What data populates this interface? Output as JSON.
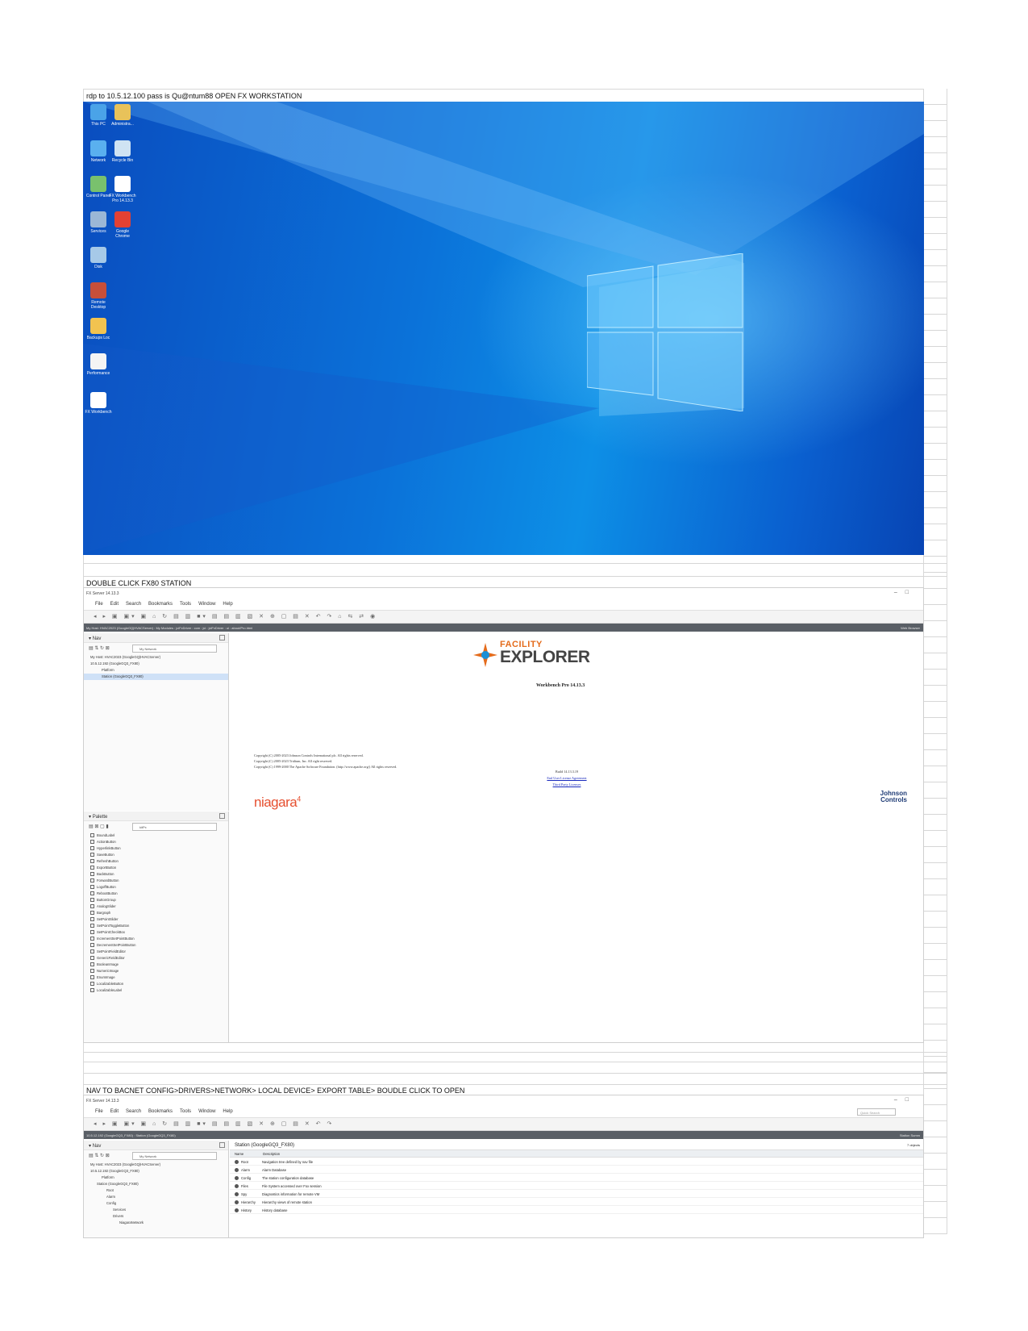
{
  "steps": {
    "step1": "rdp to 10.5.12.100 pass is Qu@ntum88     OPEN FX WORKSTATION",
    "step2": "DOUBLE CLICK FX80 STATION",
    "step3": "NAV TO BACNET CONFIG>DRIVERS>NETWORK> LOCAL DEVICE> EXPORT TABLE> BOUDLE CLICK TO OPEN"
  },
  "desktop": {
    "icons": [
      {
        "label": "This PC",
        "icon": "computer-icon",
        "color": "#4aa3e8"
      },
      {
        "label": "Administra...",
        "icon": "user-folder-icon",
        "color": "#e8c25a"
      },
      {
        "label": "Network",
        "icon": "network-icon",
        "color": "#5ab0ef"
      },
      {
        "label": "Recycle Bin",
        "icon": "recycle-bin-icon",
        "color": "#cfe3f3"
      },
      {
        "label": "Control Panel",
        "icon": "control-panel-icon",
        "color": "#79c16d"
      },
      {
        "label": "FX Workbench Pro 14.13.3",
        "icon": "fx-workbench-icon",
        "color": "#ffffff"
      },
      {
        "label": "Services",
        "icon": "gears-icon",
        "color": "#9bb7d6"
      },
      {
        "label": "Google Chrome",
        "icon": "chrome-icon",
        "color": "#e34133"
      },
      {
        "label": "Disk",
        "icon": "disk-icon",
        "color": "#a6c9e8"
      },
      {
        "label": "Remote Desktop",
        "icon": "remote-desktop-icon",
        "color": "#c74f3a"
      },
      {
        "label": "Backups Loc",
        "icon": "folder-icon",
        "color": "#f2c350"
      },
      {
        "label": "Performance",
        "icon": "gauge-icon",
        "color": "#f4f4f4"
      },
      {
        "label": "FX Workbench",
        "icon": "fx-star-icon",
        "color": "#ffffff"
      }
    ]
  },
  "wb1": {
    "title": "FX Server 14.13.3",
    "menu": [
      "File",
      "Edit",
      "Search",
      "Bookmarks",
      "Tools",
      "Window",
      "Help"
    ],
    "path": "My Host: HVAC2023 (GoogleGQ|HVACServer)   :  My Modules   :  jciFxDriver   :  com   :  jci   :  jciFxDriver   :  ui   :  about/Pro.html",
    "path_right": "Web Browser",
    "nav_title": "Nav",
    "network_select": "My Network",
    "tree": [
      "My Host: HVAC2023 (GoogleGQ|HVACServer)",
      "10.5.12.192 (GoogleGQ3_FX80)",
      "Platform",
      "Station (GoogleGQ3_FX80)"
    ],
    "palette_title": "Palette",
    "palette_select": "kitPx",
    "palette_items": [
      "BoundLabel",
      "ActionButton",
      "HyperlinkButton",
      "SaveButton",
      "RefreshButton",
      "ExportButton",
      "BackButton",
      "ForwardButton",
      "LogoffButton",
      "RebootButton",
      "ButtonGroup",
      "AnalogSlider",
      "Bargraph",
      "SetPointSlider",
      "SetPointToggleButton",
      "SetPointCheckBox",
      "IncrementSetPointButton",
      "DecrementSetPointButton",
      "SetPointFieldEditor",
      "GenericFieldEditor",
      "BooleanImage",
      "NumericImage",
      "EnumImage",
      "LocalizableButton",
      "LocalizableLabel"
    ],
    "about": {
      "logo_top": "FACILITY",
      "logo_main": "EXPLORER",
      "version": "Workbench Pro 14.13.3",
      "copyright": [
        "Copyright (C) 2005-2023 Johnson Controls International plc. All rights reserved.",
        "Copyright (C) 2005-2023 Tridium, Inc. All right reserved.",
        "Copyright (C) 1999-2000 The Apache Software Foundation. (http://www.apache.org/) All rights reserved."
      ],
      "build": "Build 14.13.3.19",
      "eula": "End User License Agreement",
      "third_party": "Third Party Licenses",
      "niagara": "niagara",
      "niagara_sup": "4",
      "jci_line1": "Johnson",
      "jci_line2": "Controls"
    }
  },
  "wb2": {
    "title": "FX Server 14.13.3",
    "menu": [
      "File",
      "Edit",
      "Search",
      "Bookmarks",
      "Tools",
      "Window",
      "Help"
    ],
    "quick_search": "Quick Search",
    "path": "10.5.12.192 (GoogleGQ3_FX80)   :  Station (GoogleGQ3_FX80)",
    "path_right": "Station Summ",
    "nav_title": "Nav",
    "network_select": "My Network",
    "tree": [
      "My Host: HVAC2023 (GoogleGQ|HVACServer)",
      "10.5.12.192 (GoogleGQ3_FX80)",
      "Platform",
      "Station (GoogleGQ3_FX80)",
      "Root",
      "Alarm",
      "Config",
      "Services",
      "Drivers",
      "NiagaraNetwork"
    ],
    "station_title": "Station (GoogleGQ3_FX80)",
    "object_count": "7 objects",
    "columns": [
      "Name",
      "Description"
    ],
    "rows": [
      {
        "name": "Root",
        "desc": "Navigation tree defined by nav file"
      },
      {
        "name": "Alarm",
        "desc": "Alarm Database"
      },
      {
        "name": "Config",
        "desc": "The station configuration database"
      },
      {
        "name": "Files",
        "desc": "File System accessed over Fox session"
      },
      {
        "name": "Spy",
        "desc": "Diagnostics information for remote VM"
      },
      {
        "name": "Hierarchy",
        "desc": "Hierarchy views of remote station"
      },
      {
        "name": "History",
        "desc": "History database"
      }
    ]
  }
}
